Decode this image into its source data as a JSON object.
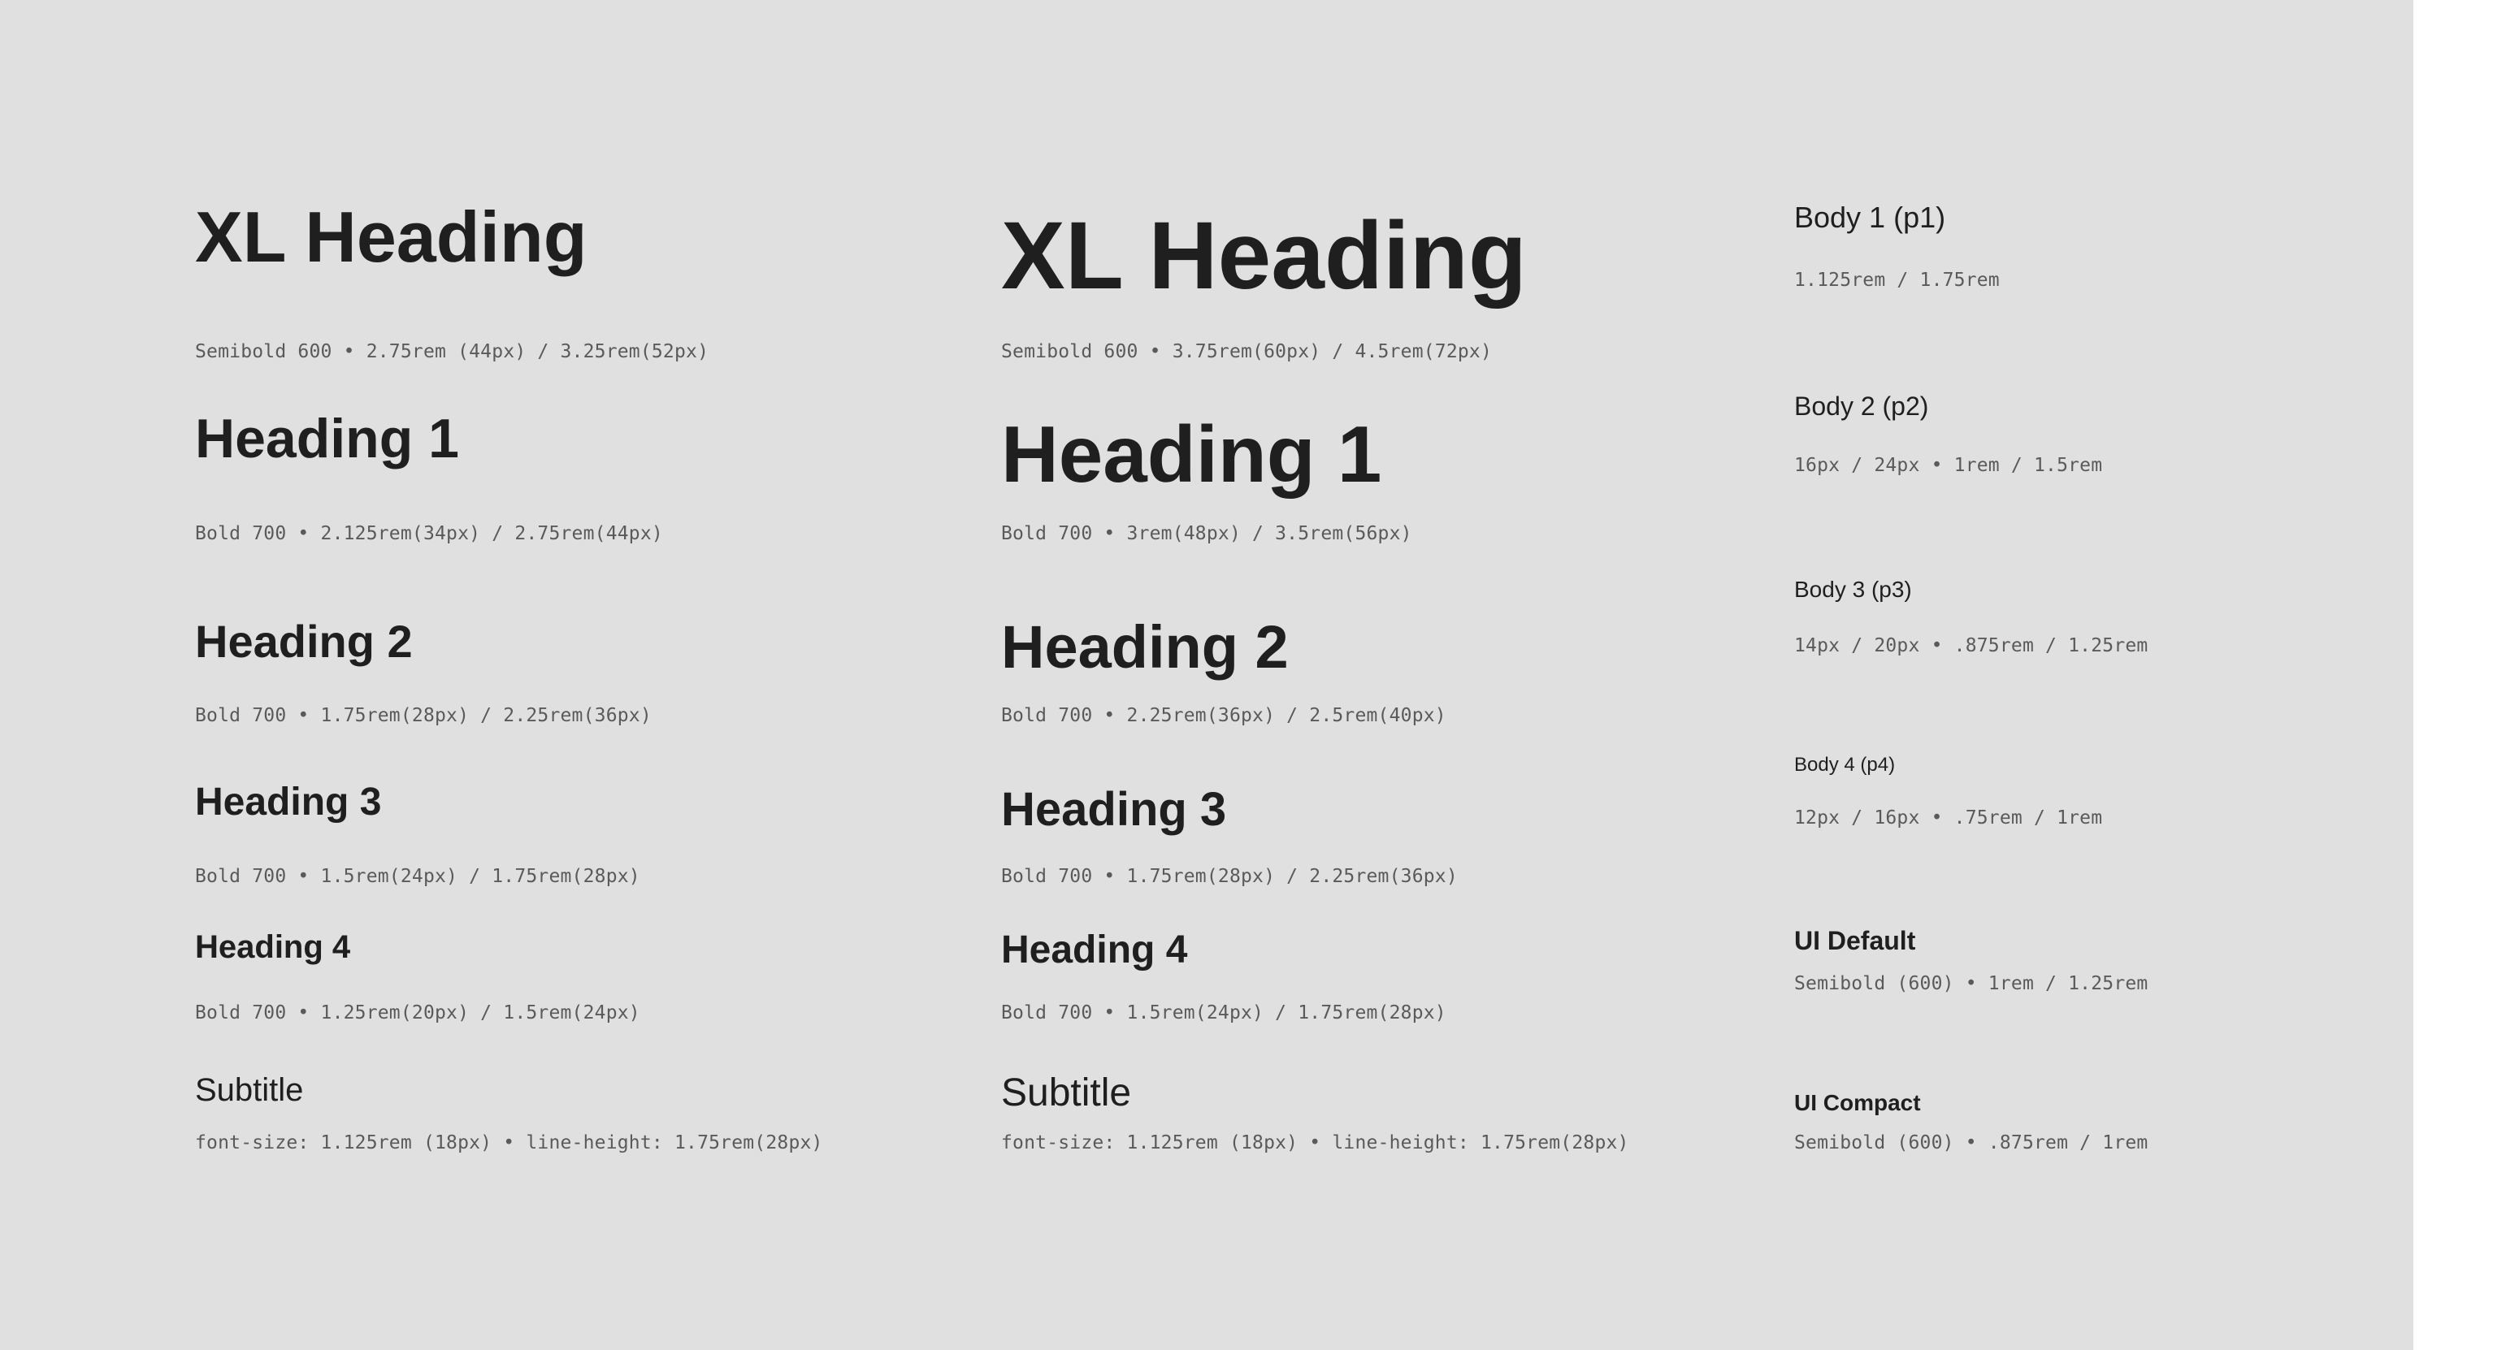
{
  "small_scale": {
    "xl_heading": {
      "sample": "XL Heading",
      "spec": "Semibold 600 • 2.75rem (44px) / 3.25rem(52px)"
    },
    "heading_1": {
      "sample": "Heading 1",
      "spec": "Bold 700 • 2.125rem(34px) / 2.75rem(44px)"
    },
    "heading_2": {
      "sample": "Heading 2",
      "spec": "Bold 700 • 1.75rem(28px) / 2.25rem(36px)"
    },
    "heading_3": {
      "sample": "Heading 3",
      "spec": "Bold 700 • 1.5rem(24px) / 1.75rem(28px)"
    },
    "heading_4": {
      "sample": "Heading 4",
      "spec": "Bold 700 • 1.25rem(20px) / 1.5rem(24px)"
    },
    "subtitle": {
      "sample": "Subtitle",
      "spec": "font-size: 1.125rem (18px) • line-height: 1.75rem(28px)"
    }
  },
  "large_scale": {
    "xl_heading": {
      "sample": "XL Heading",
      "spec": "Semibold 600 • 3.75rem(60px) / 4.5rem(72px)"
    },
    "heading_1": {
      "sample": "Heading 1",
      "spec": "Bold 700 • 3rem(48px) / 3.5rem(56px)"
    },
    "heading_2": {
      "sample": "Heading 2",
      "spec": "Bold 700 • 2.25rem(36px) / 2.5rem(40px)"
    },
    "heading_3": {
      "sample": "Heading 3",
      "spec": "Bold 700 • 1.75rem(28px) / 2.25rem(36px)"
    },
    "heading_4": {
      "sample": "Heading 4",
      "spec": "Bold 700 • 1.5rem(24px) / 1.75rem(28px)"
    },
    "subtitle": {
      "sample": "Subtitle",
      "spec": "font-size: 1.125rem (18px) • line-height: 1.75rem(28px)"
    }
  },
  "body_scale": {
    "body_1": {
      "sample": "Body 1 (p1)",
      "spec": "1.125rem / 1.75rem"
    },
    "body_2": {
      "sample": "Body 2 (p2)",
      "spec": "16px / 24px • 1rem / 1.5rem"
    },
    "body_3": {
      "sample": "Body 3 (p3)",
      "spec": "14px / 20px • .875rem / 1.25rem"
    },
    "body_4": {
      "sample": "Body 4 (p4)",
      "spec": "12px / 16px • .75rem / 1rem"
    },
    "ui_default": {
      "sample": "UI Default",
      "spec": "Semibold (600) • 1rem / 1.25rem"
    },
    "ui_compact": {
      "sample": "UI Compact",
      "spec": "Semibold (600) • .875rem / 1rem"
    }
  },
  "colors": {
    "canvas_background": "#e0e0e0",
    "page_background": "#ffffff",
    "sample_text": "#1f1f1f",
    "spec_text": "#5a5a5a"
  }
}
